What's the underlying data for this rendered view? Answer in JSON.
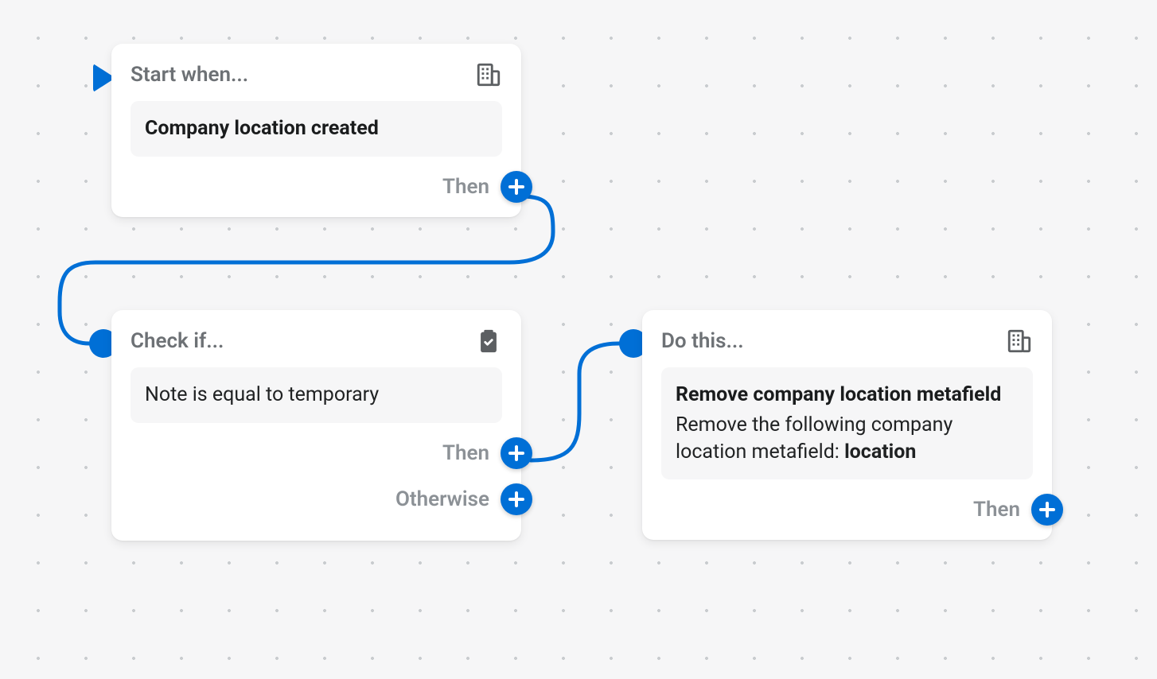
{
  "nodes": {
    "start": {
      "label": "Start when...",
      "icon": "company-icon",
      "title": "Company location created",
      "then_label": "Then"
    },
    "check": {
      "label": "Check if...",
      "icon": "clipboard-check-icon",
      "condition": "Note is equal to temporary",
      "then_label": "Then",
      "otherwise_label": "Otherwise"
    },
    "do": {
      "label": "Do this...",
      "icon": "company-icon",
      "title": "Remove company location metafield",
      "description_prefix": "Remove the following company location metafield: ",
      "description_value": "location",
      "then_label": "Then"
    }
  },
  "colors": {
    "accent": "#006fd6",
    "text_muted": "#6d7175",
    "bg": "#f6f6f7"
  }
}
